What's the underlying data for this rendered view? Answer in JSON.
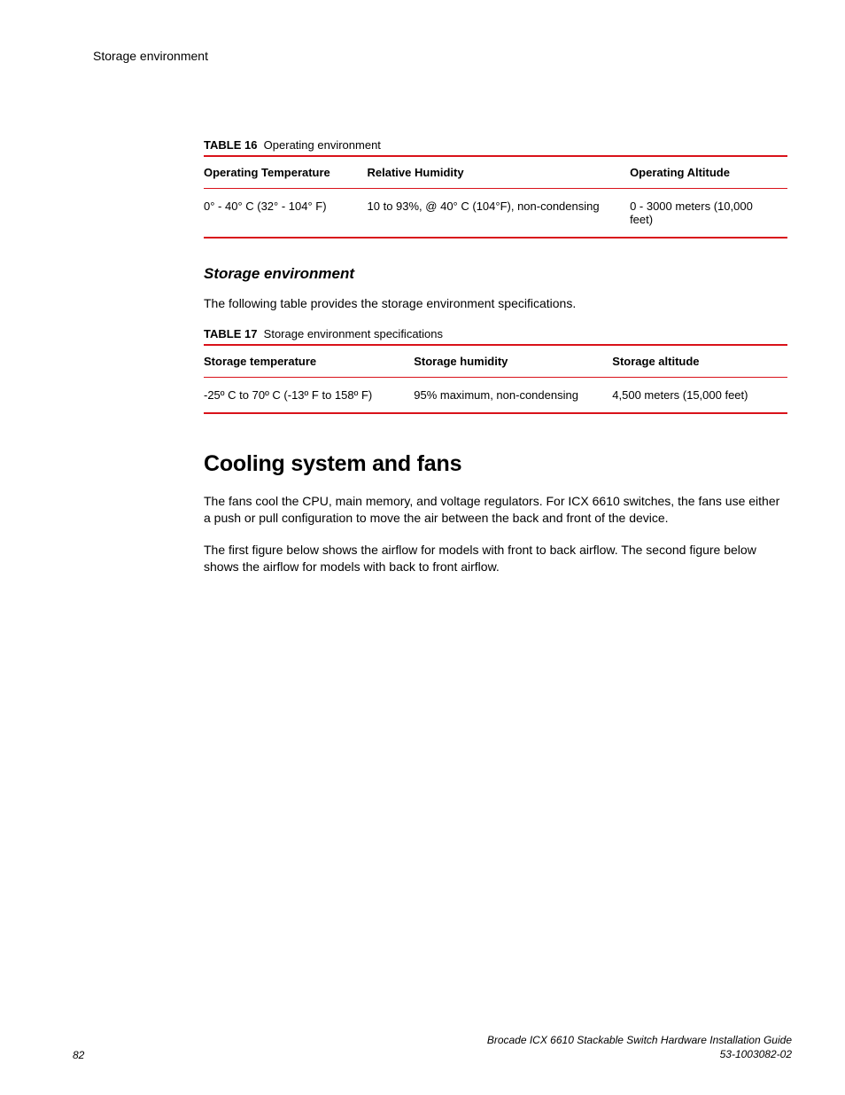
{
  "runningHead": "Storage environment",
  "table16": {
    "caption_bold": "TABLE 16",
    "caption_rest": "Operating environment",
    "headers": [
      "Operating Temperature",
      "Relative Humidity",
      "Operating Altitude"
    ],
    "row": [
      "0° - 40° C (32° - 104° F)",
      "10 to 93%, @ 40° C (104°F), non-condensing",
      "0 - 3000 meters (10,000 feet)"
    ]
  },
  "subheading1": "Storage environment",
  "para1": "The following table provides the storage environment specifications.",
  "table17": {
    "caption_bold": "TABLE 17",
    "caption_rest": "Storage environment specifications",
    "headers": [
      "Storage temperature",
      "Storage humidity",
      "Storage altitude"
    ],
    "row": [
      "-25º C to 70º C (-13º F to 158º F)",
      "95% maximum, non-condensing",
      "4,500 meters (15,000 feet)"
    ]
  },
  "h2": "Cooling system and fans",
  "para2": "The fans cool the CPU, main memory, and voltage regulators. For ICX 6610 switches, the fans use either a push or pull configuration to move the air between the back and front of the device.",
  "para3": "The first figure below shows the airflow for models with front to back airflow. The second figure below shows the airflow for models with back to front airflow.",
  "footer": {
    "pageNumber": "82",
    "title": "Brocade ICX 6610 Stackable Switch Hardware Installation Guide",
    "docNumber": "53-1003082-02"
  }
}
